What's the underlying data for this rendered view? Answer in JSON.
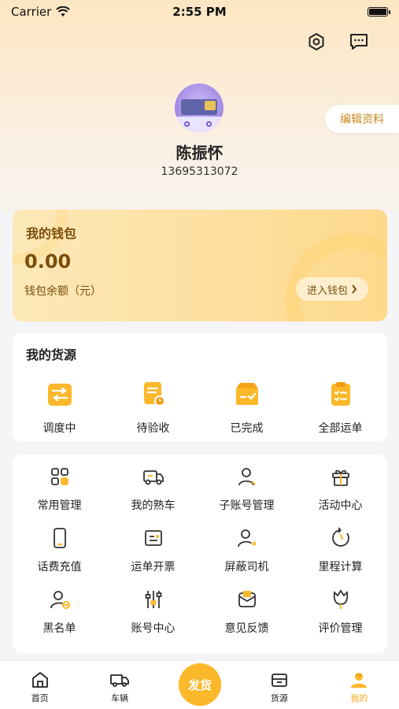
{
  "status_bar": {
    "carrier": "Carrier",
    "time": "2:55 PM"
  },
  "header": {
    "edit_profile": "编辑资料",
    "user_name": "陈振怀",
    "user_phone": "13695313072"
  },
  "wallet": {
    "title": "我的钱包",
    "amount": "0.00",
    "balance_label": "钱包余额（元）",
    "enter_button": "进入钱包"
  },
  "goods": {
    "title": "我的货源",
    "items": [
      {
        "label": "调度中",
        "icon": "dispatch-icon"
      },
      {
        "label": "待验收",
        "icon": "pending-check-icon"
      },
      {
        "label": "已完成",
        "icon": "completed-box-icon"
      },
      {
        "label": "全部运单",
        "icon": "clipboard-list-icon"
      }
    ]
  },
  "tools": {
    "items": [
      {
        "label": "常用管理",
        "icon": "grid-icon"
      },
      {
        "label": "我的熟车",
        "icon": "truck-icon"
      },
      {
        "label": "子账号管理",
        "icon": "user-icon"
      },
      {
        "label": "活动中心",
        "icon": "gift-icon"
      },
      {
        "label": "话费充值",
        "icon": "phone-icon"
      },
      {
        "label": "运单开票",
        "icon": "invoice-icon"
      },
      {
        "label": "屏蔽司机",
        "icon": "block-user-icon"
      },
      {
        "label": "里程计算",
        "icon": "mileage-icon"
      },
      {
        "label": "黑名单",
        "icon": "blacklist-icon"
      },
      {
        "label": "账号中心",
        "icon": "sliders-icon"
      },
      {
        "label": "意见反馈",
        "icon": "feedback-icon"
      },
      {
        "label": "评价管理",
        "icon": "rating-icon"
      }
    ]
  },
  "tabbar": {
    "home": "首页",
    "vehicles": "车辆",
    "publish": "发货",
    "cargo": "货源",
    "mine": "我的",
    "active": "mine"
  },
  "colors": {
    "accent": "#f2a81d",
    "wallet_text": "#7a4e0a"
  }
}
